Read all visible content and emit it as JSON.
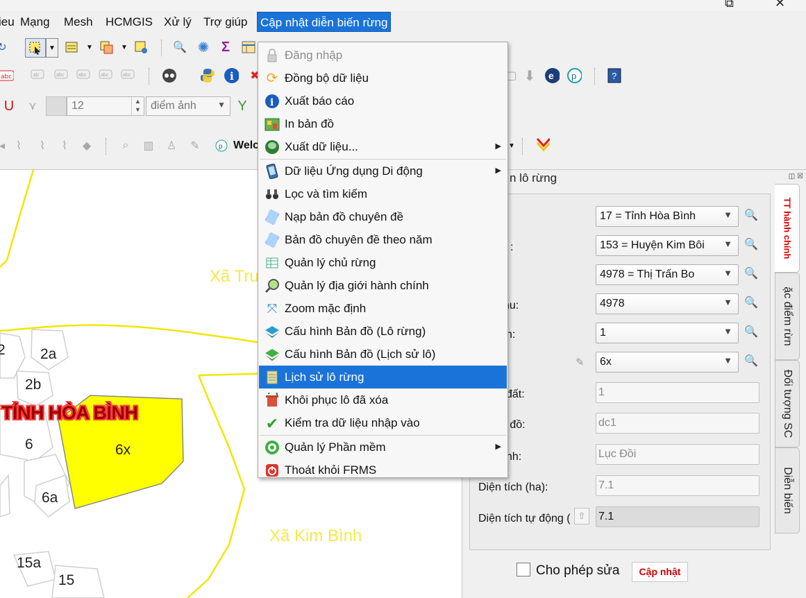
{
  "menubar": [
    {
      "label": "ieu"
    },
    {
      "label": "Mạng"
    },
    {
      "label": "Mesh"
    },
    {
      "label": "HCMGIS"
    },
    {
      "label": "Xử lý"
    },
    {
      "label": "Trợ giúp"
    },
    {
      "label": "Cập nhật diễn biến rừng",
      "active": true
    }
  ],
  "toolbar": {
    "spin_value": "12",
    "unit_value": "điểm ảnh",
    "welcome_text": "Welc"
  },
  "dropdown": {
    "items": [
      {
        "label": "Đăng nhập",
        "icon": "lock-icon",
        "disabled": true
      },
      {
        "label": "Đồng bộ dữ liệu",
        "icon": "sync-icon"
      },
      {
        "label": "Xuất báo cáo",
        "icon": "info-icon"
      },
      {
        "label": "In bản đồ",
        "icon": "print-map-icon"
      },
      {
        "label": "Xuất dữ liệu...",
        "icon": "postgres-icon",
        "submenu": true
      },
      {
        "label": "Dữ liệu Ứng dụng Di động",
        "icon": "mobile-icon",
        "submenu": true
      },
      {
        "label": "Lọc và tìm kiếm",
        "icon": "binoculars-icon"
      },
      {
        "label": "Nạp bản đồ chuyên đề",
        "icon": "layers-icon"
      },
      {
        "label": "Bản đồ chuyên đề theo năm",
        "icon": "layers-year-icon"
      },
      {
        "label": "Quản lý chủ rừng",
        "icon": "table-icon"
      },
      {
        "label": "Quản lý địa giới hành chính",
        "icon": "zoom-search-icon"
      },
      {
        "label": "Zoom mặc định",
        "icon": "zoom-extent-icon"
      },
      {
        "label": "Cấu hình Bản đồ (Lô rừng)",
        "icon": "layer-blue-icon"
      },
      {
        "label": "Cấu hình Bản đồ (Lịch sử lô)",
        "icon": "layer-green-icon"
      },
      {
        "label": "Lịch sử lô rừng",
        "icon": "history-icon",
        "highlight": true
      },
      {
        "label": "Khôi phục lô đã xóa",
        "icon": "restore-icon"
      },
      {
        "label": "Kiểm tra dữ liệu nhập vào",
        "icon": "check-icon"
      },
      {
        "label": "Quản lý Phần mềm",
        "icon": "software-icon",
        "submenu": true
      },
      {
        "label": "Thoát khỏi FRMS",
        "icon": "power-icon"
      }
    ]
  },
  "map": {
    "labels": {
      "xa_tru": "Xã Tru",
      "xa_kim_binh": "Xã Kim Bình",
      "province": "TỈNH HÒA BÌNH"
    },
    "parcels": [
      "2",
      "2a",
      "2b",
      "6",
      "6x",
      "6a",
      "15a",
      "15"
    ]
  },
  "panel": {
    "title": "n lô rừng",
    "tabs": [
      "TT hành chính",
      "ặc điểm rừn",
      "Đối tượng SC",
      "Diễn biến"
    ],
    "labels": {
      "huyen": ":",
      "khu": "hu:",
      "lo": "h:",
      "ma_dat": "đất:",
      "ban_do": "n đồ:",
      "dia_danh": "nh:",
      "dien_tich": "Diện tích (ha):",
      "dien_tich_td": "Diện tích tự động ("
    },
    "combos": {
      "tinh": "17 = Tỉnh Hòa Bình",
      "huyen": "153 = Huyện Kim Bôi",
      "xa": "4978 = Thị Trấn Bo",
      "tieu_khu": "4978",
      "khoanh": "1",
      "lo": "6x"
    },
    "fields": {
      "ma_dat": "1",
      "ban_do": "dc1",
      "dia_danh": "Lục Đồi",
      "dien_tich": "7.1",
      "dien_tich_td": "7.1"
    },
    "allow_edit": "Cho phép sửa",
    "update_button": "Cập nhật"
  },
  "colors": {
    "menu_highlight": "#1a73d9",
    "boundary": "#f2e600",
    "parcel_fill": "#ffff00",
    "province_text": "#9b0000"
  }
}
